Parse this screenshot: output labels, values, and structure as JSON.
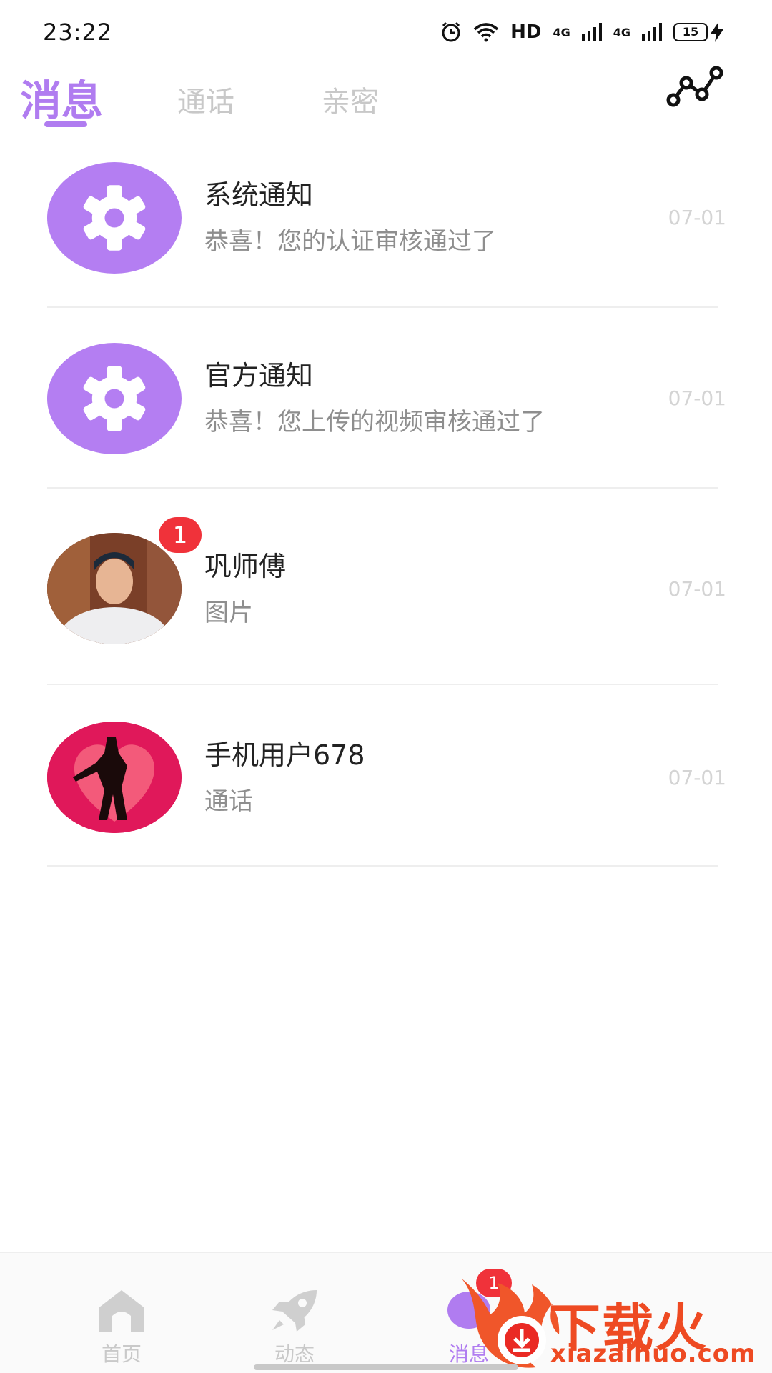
{
  "status": {
    "time": "23:22",
    "hd": "HD",
    "net1": "4G",
    "net2": "4G",
    "battery": "15"
  },
  "tabs": [
    {
      "label": "消息",
      "active": true
    },
    {
      "label": "通话",
      "active": false
    },
    {
      "label": "亲密",
      "active": false
    }
  ],
  "conversations": [
    {
      "name": "系统通知",
      "message": "恭喜！您的认证审核通过了",
      "time": "07-01",
      "avatar": "gear-icon"
    },
    {
      "name": "官方通知",
      "message": "恭喜！您上传的视频审核通过了",
      "time": "07-01",
      "avatar": "gear-icon"
    },
    {
      "name": "巩师傅",
      "message": "图片",
      "time": "07-01",
      "avatar": "user-photo",
      "badge": "1"
    },
    {
      "name": "手机用户678",
      "message": "通话",
      "time": "07-01",
      "avatar": "couple-heart-avatar"
    }
  ],
  "bottom_nav": {
    "home": "首页",
    "feed": "动态",
    "messages": "消息",
    "messages_badge": "1"
  },
  "watermark": {
    "title": "下载火",
    "url": "xiazaihuo.com"
  },
  "colors": {
    "accent": "#b07cf0",
    "badge": "#f0323a",
    "watermark": "#ee4a22"
  }
}
